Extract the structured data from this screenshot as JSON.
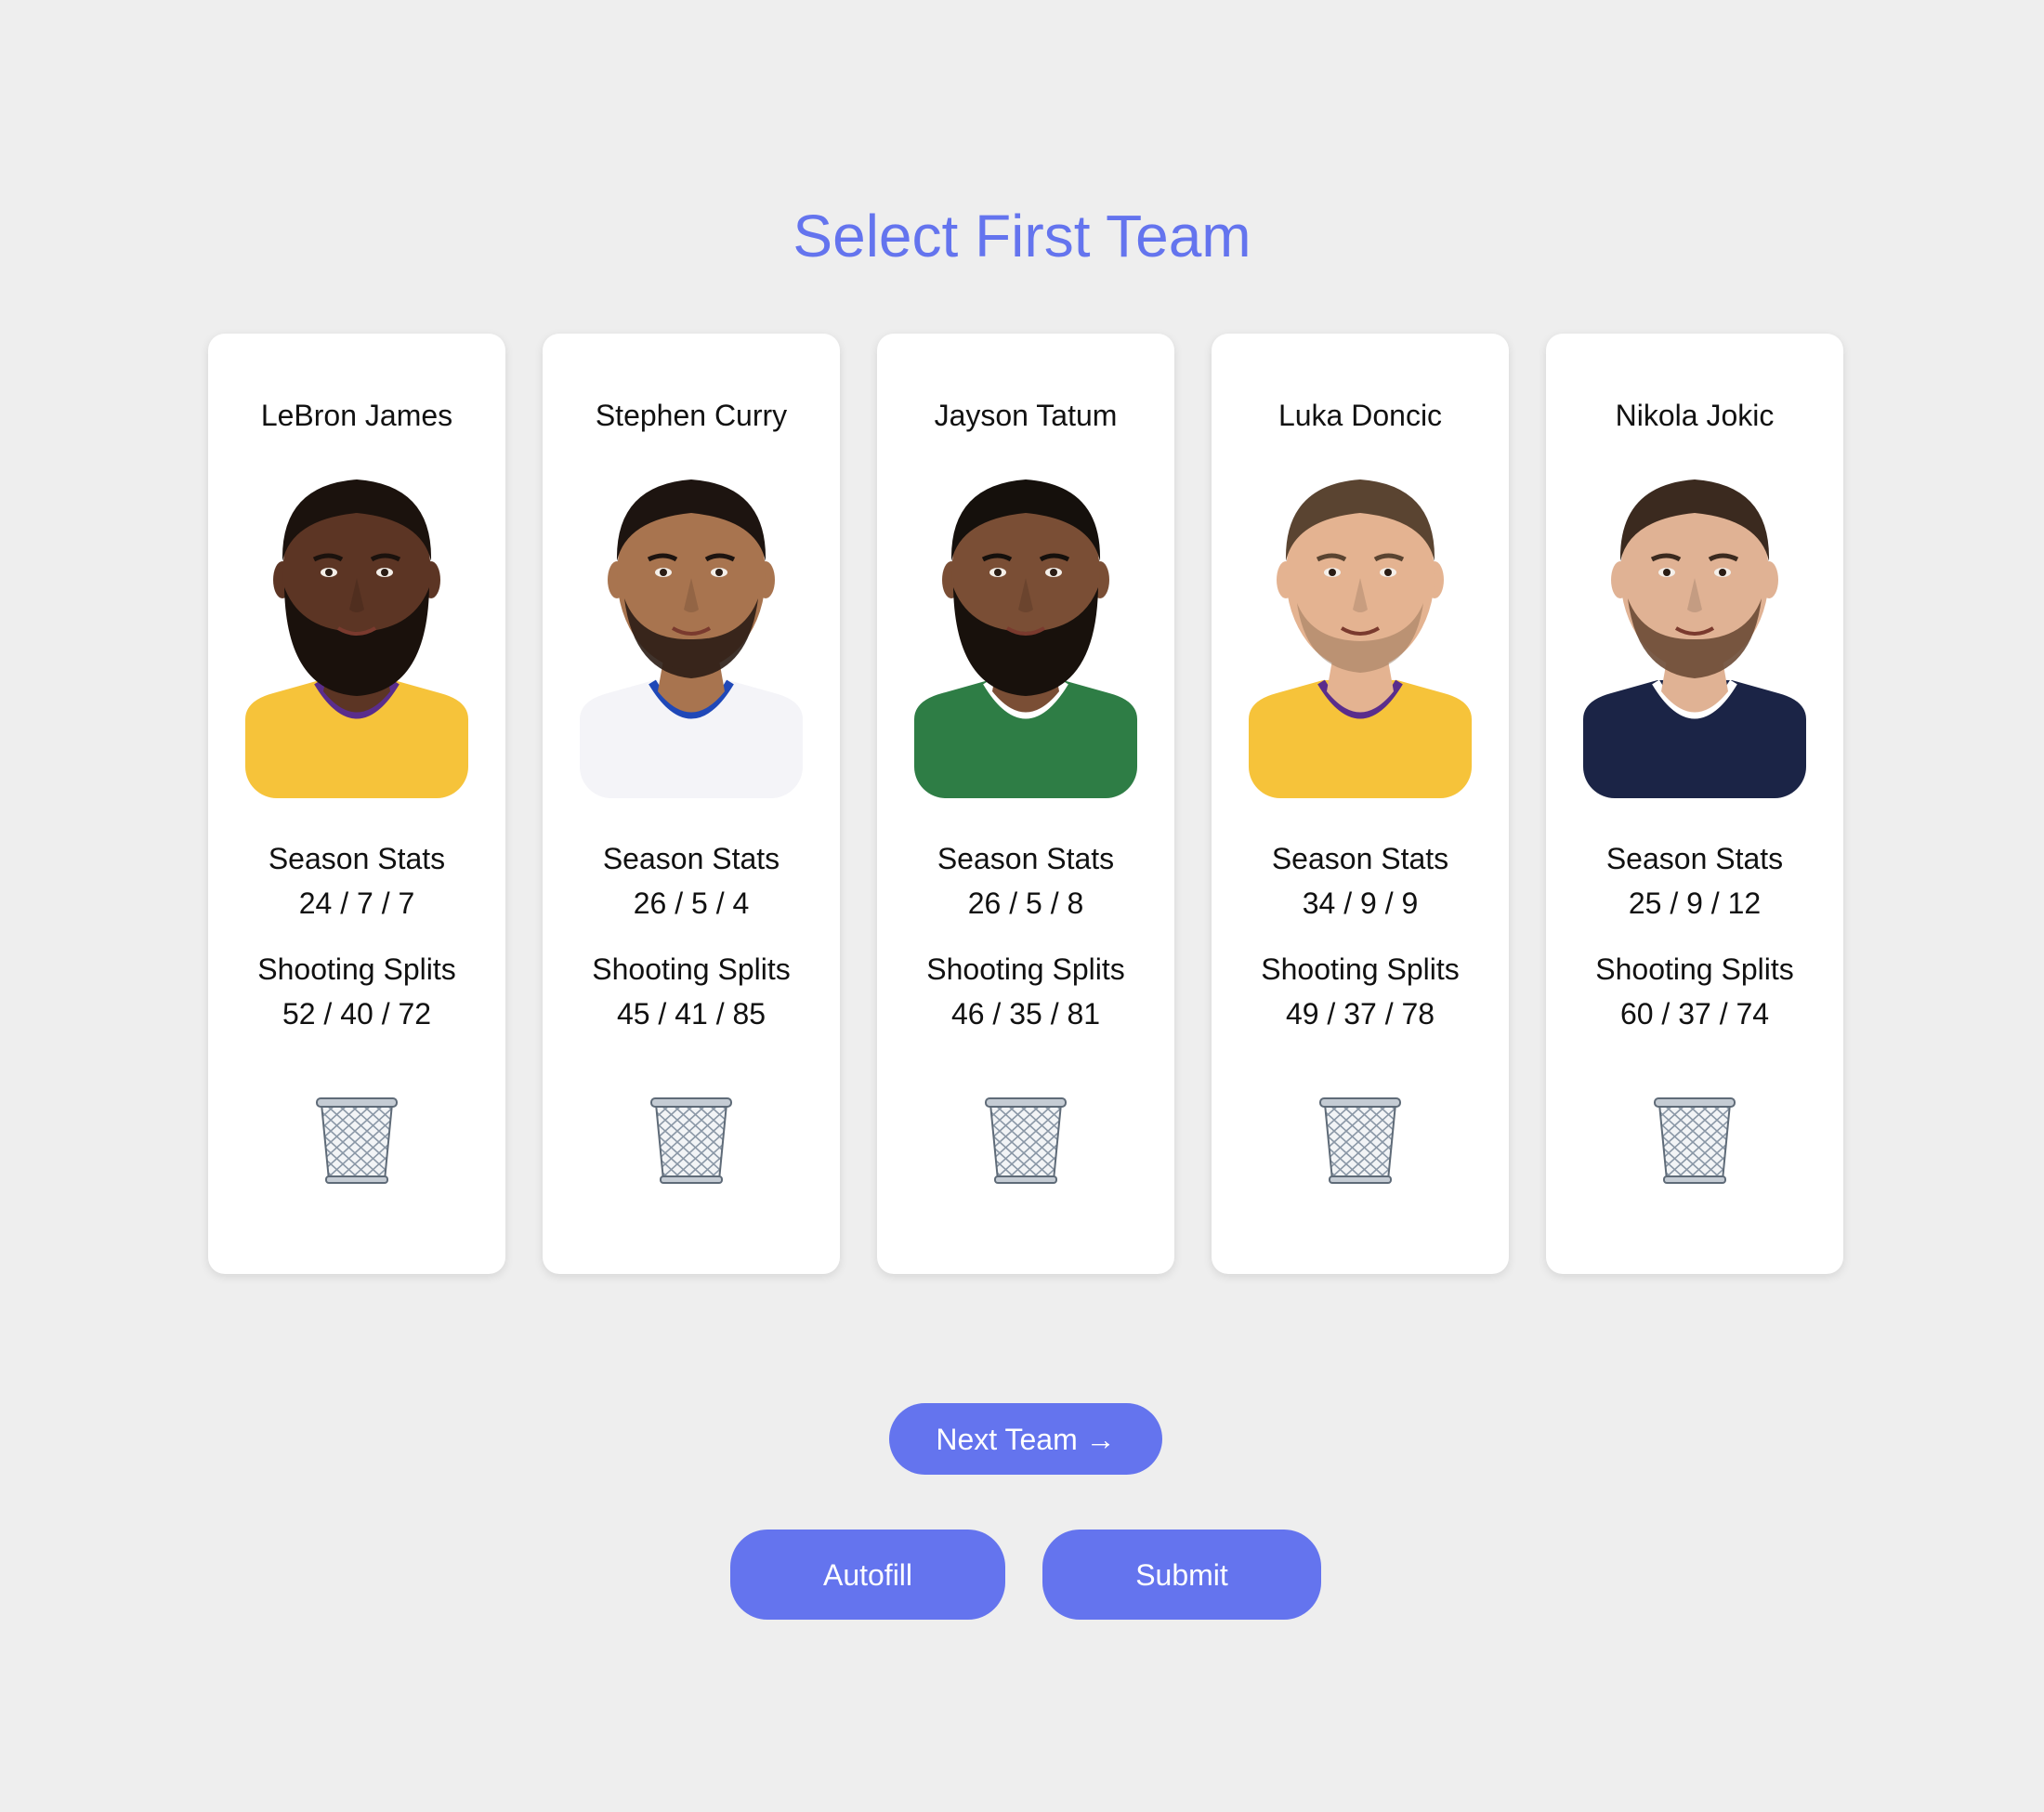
{
  "page": {
    "title": "Select First Team"
  },
  "players": [
    {
      "name": "LeBron James",
      "season_stats_label": "Season Stats",
      "season_stats": "24 / 7 / 7",
      "shooting_label": "Shooting Splits",
      "shooting_splits": "52 / 40 / 72",
      "photo": {
        "skin": "#5c3524",
        "hair": "#1b120d",
        "beard": "#1a110c",
        "jersey": "#f6c33a",
        "trim": "#5a2d8c",
        "beard_type": "full"
      }
    },
    {
      "name": "Stephen Curry",
      "season_stats_label": "Season Stats",
      "season_stats": "26 / 5 / 4",
      "shooting_label": "Shooting Splits",
      "shooting_splits": "45 / 41 / 85",
      "photo": {
        "skin": "#a8744f",
        "hair": "#1d1410",
        "beard": "#2b1d15",
        "jersey": "#f4f4f8",
        "trim": "#1f48b8",
        "beard_type": "short"
      }
    },
    {
      "name": "Jayson Tatum",
      "season_stats_label": "Season Stats",
      "season_stats": "26 / 5 / 8",
      "shooting_label": "Shooting Splits",
      "shooting_splits": "46 / 35 / 81",
      "photo": {
        "skin": "#7a4e35",
        "hair": "#15100c",
        "beard": "#18110c",
        "jersey": "#2e7d45",
        "trim": "#ffffff",
        "beard_type": "full"
      }
    },
    {
      "name": "Luka Doncic",
      "season_stats_label": "Season Stats",
      "season_stats": "34 / 9 / 9",
      "shooting_label": "Shooting Splits",
      "shooting_splits": "49 / 37 / 78",
      "photo": {
        "skin": "#e4b391",
        "hair": "#5a4431",
        "beard": "#8a6a50",
        "jersey": "#f6c33a",
        "trim": "#5a2d8c",
        "beard_type": "stubble"
      }
    },
    {
      "name": "Nikola Jokic",
      "season_stats_label": "Season Stats",
      "season_stats": "25 / 9 / 12",
      "shooting_label": "Shooting Splits",
      "shooting_splits": "60 / 37 / 74",
      "photo": {
        "skin": "#e0b294",
        "hair": "#3b2a1f",
        "beard": "#6b4a35",
        "jersey": "#1b2446",
        "trim": "#ffffff",
        "beard_type": "short"
      }
    }
  ],
  "actions": {
    "next_team_label": "Next Team →",
    "autofill_label": "Autofill",
    "submit_label": "Submit"
  },
  "colors": {
    "accent": "#6474ee",
    "background": "#eeeeee",
    "card": "#ffffff"
  },
  "icons": {
    "remove": "wastebasket-icon"
  }
}
